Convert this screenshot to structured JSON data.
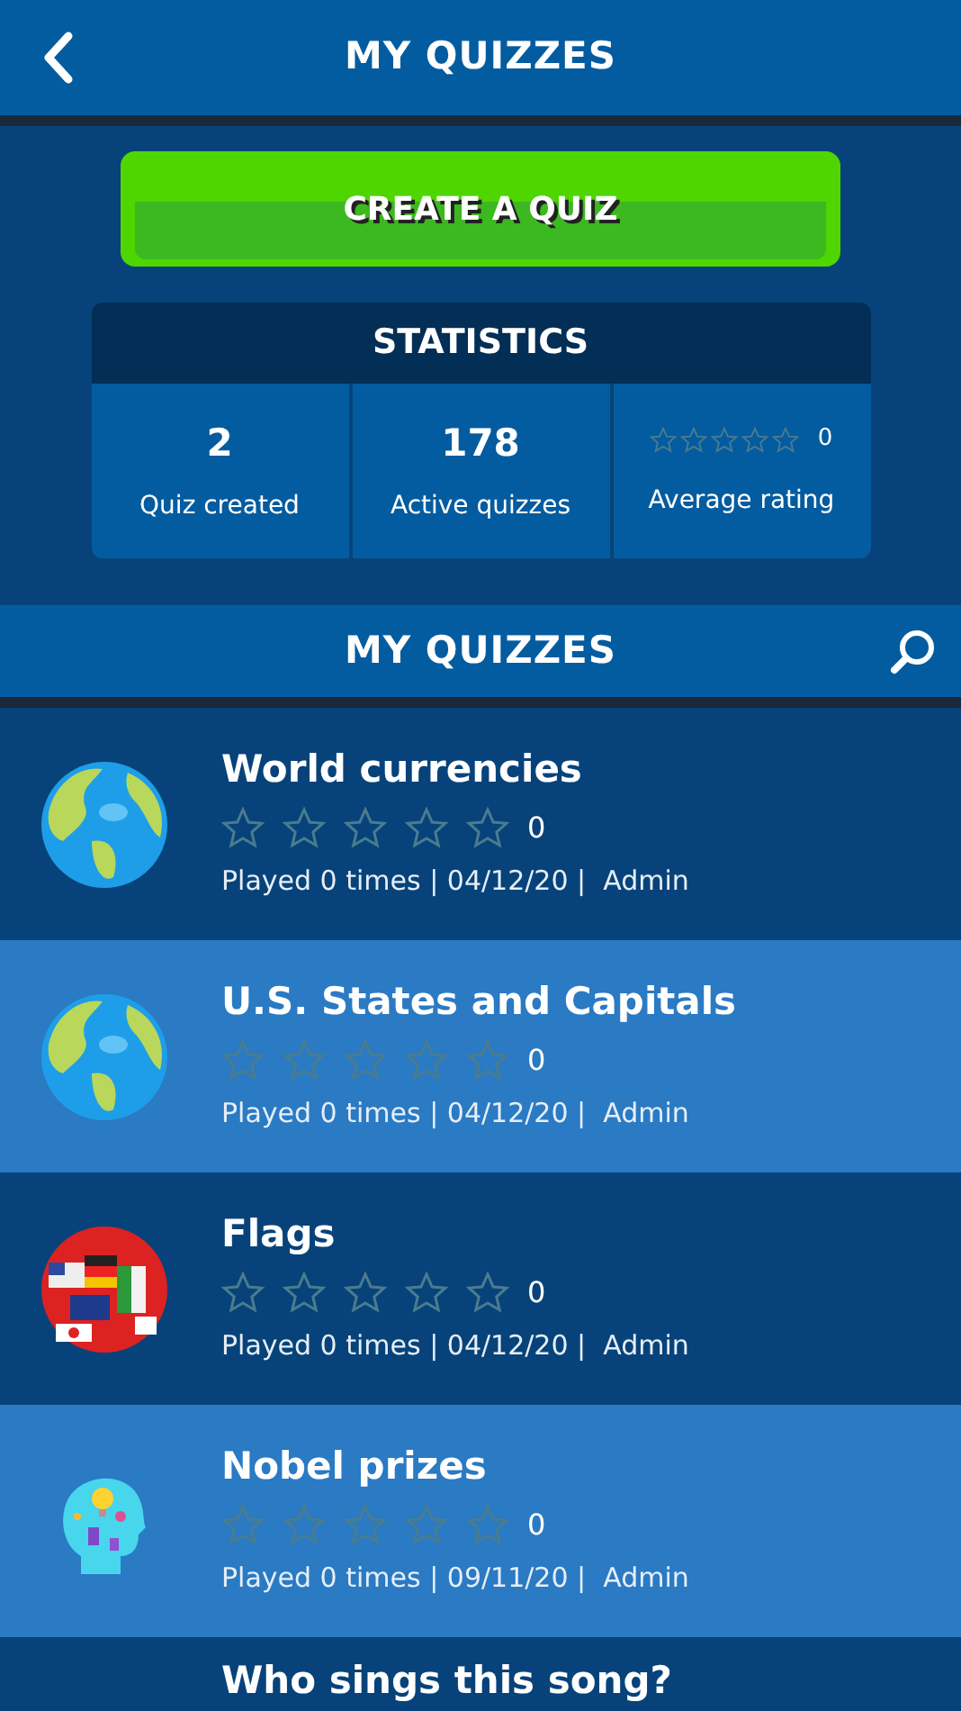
{
  "header": {
    "title": "MY QUIZZES"
  },
  "create_button": "CREATE A QUIZ",
  "statistics": {
    "title": "STATISTICS",
    "cells": [
      {
        "kind": "number",
        "value": "2",
        "label": "Quiz created"
      },
      {
        "kind": "number",
        "value": "178",
        "label": "Active quizzes"
      },
      {
        "kind": "rating",
        "stars": 0,
        "count": "0",
        "label": "Average rating"
      }
    ]
  },
  "section": {
    "title": "MY QUIZZES"
  },
  "quizzes": [
    {
      "title": "World currencies",
      "kind": "globe",
      "stars": 0,
      "count": "0",
      "meta": "Played 0 times | 04/12/20 |  Admin"
    },
    {
      "title": "U.S. States and Capitals",
      "kind": "globe",
      "stars": 0,
      "count": "0",
      "meta": "Played 0 times | 04/12/20 |  Admin"
    },
    {
      "title": "Flags",
      "kind": "flags",
      "stars": 0,
      "count": "0",
      "meta": "Played 0 times | 04/12/20 |  Admin"
    },
    {
      "title": "Nobel prizes",
      "kind": "head",
      "stars": 0,
      "count": "0",
      "meta": "Played 0 times | 09/11/20 |  Admin"
    },
    {
      "title": "Who sings this song?"
    }
  ]
}
